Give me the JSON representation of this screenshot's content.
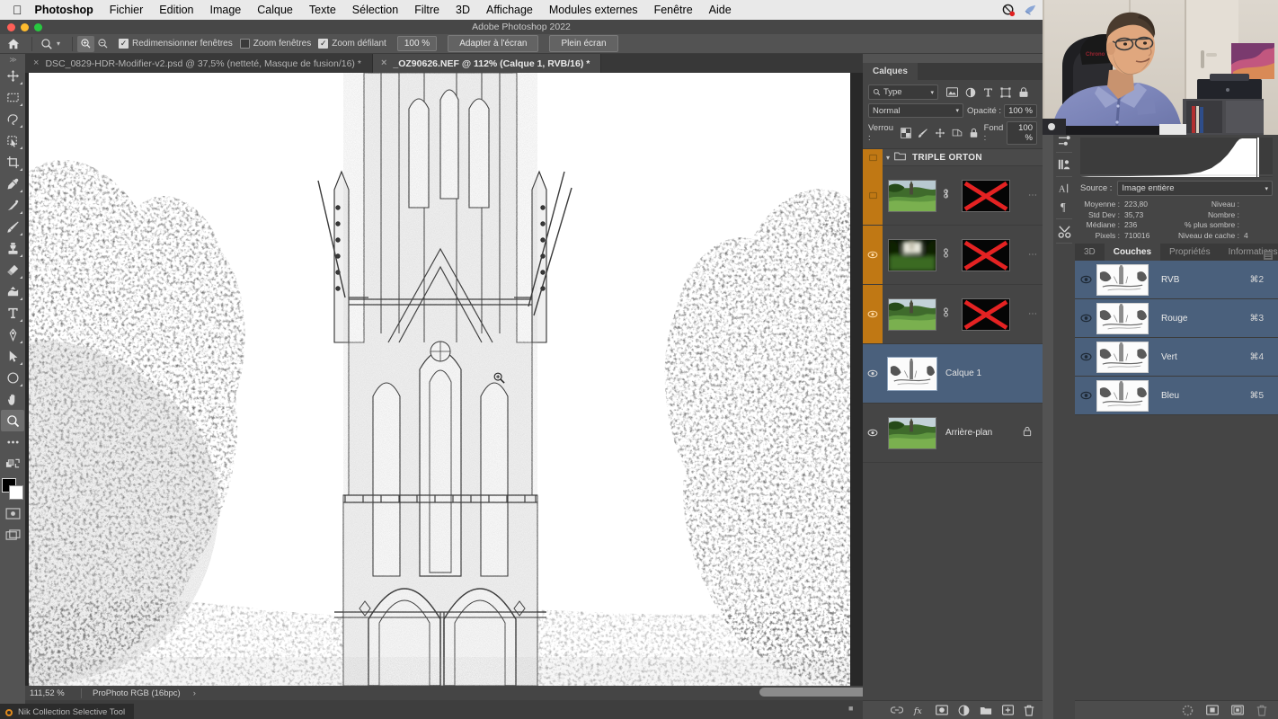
{
  "menubar": {
    "apple_icon": "apple-logo-icon",
    "items": [
      {
        "label": "Photoshop",
        "bold": true
      },
      {
        "label": "Fichier",
        "bold": false
      },
      {
        "label": "Edition",
        "bold": false
      },
      {
        "label": "Image",
        "bold": false
      },
      {
        "label": "Calque",
        "bold": false
      },
      {
        "label": "Texte",
        "bold": false
      },
      {
        "label": "Sélection",
        "bold": false
      },
      {
        "label": "Filtre",
        "bold": false
      },
      {
        "label": "3D",
        "bold": false
      },
      {
        "label": "Affichage",
        "bold": false
      },
      {
        "label": "Modules externes",
        "bold": false
      },
      {
        "label": "Fenêtre",
        "bold": false
      },
      {
        "label": "Aide",
        "bold": false
      }
    ],
    "status_icons": [
      "recording-icon",
      "bird-icon",
      "notification-dots-icon",
      "camera-video-icon",
      "display-icon",
      "clipboard-icon",
      "time-machine-icon",
      "binoculars-icon",
      "sidebar-icon",
      "monitor-icon",
      "volume-icon",
      "play-circle-icon",
      "user-icon"
    ]
  },
  "window": {
    "title": "Adobe Photoshop 2022",
    "traffic_lights": [
      "close-button",
      "minimize-button",
      "maximize-button"
    ],
    "traffic_colors": {
      "close": "#ff5f57",
      "minimize": "#febc2e",
      "maximize": "#28c840"
    }
  },
  "options_bar": {
    "home_icon": "home-icon",
    "tool_icon": "zoom-tool-icon",
    "chevron": "chevron-down-icon",
    "zoom_in_icon": "zoom-in-icon",
    "zoom_out_icon": "zoom-out-icon",
    "checkboxes": [
      {
        "label": "Redimensionner fenêtres",
        "checked": true,
        "mark": "✓"
      },
      {
        "label": "Zoom fenêtres",
        "checked": false,
        "mark": ""
      },
      {
        "label": "Zoom défilant",
        "checked": true,
        "mark": "✓"
      }
    ],
    "zoom_level": "100 %",
    "fit_screen_label": "Adapter à l'écran",
    "fullscreen_label": "Plein écran"
  },
  "tabs": [
    {
      "label": "DSC_0829-HDR-Modifier-v2.psd @ 37,5% (netteté, Masque de fusion/16) *",
      "active": false,
      "close": "×"
    },
    {
      "label": "_OZ90626.NEF @ 112% (Calque 1, RVB/16) *",
      "active": true,
      "close": "×"
    }
  ],
  "toolbar": {
    "tools": [
      {
        "name": "move-tool",
        "selected": false
      },
      {
        "name": "rectangular-marquee-tool",
        "selected": false
      },
      {
        "name": "lasso-tool",
        "selected": false
      },
      {
        "name": "object-selection-tool",
        "selected": false
      },
      {
        "name": "crop-tool",
        "selected": false
      },
      {
        "name": "eyedropper-tool",
        "selected": false
      },
      {
        "name": "healing-brush-tool",
        "selected": false
      },
      {
        "name": "brush-tool",
        "selected": false
      },
      {
        "name": "clone-stamp-tool",
        "selected": false
      },
      {
        "name": "eraser-tool",
        "selected": false
      },
      {
        "name": "gradient-tool",
        "selected": false
      },
      {
        "name": "type-tool",
        "selected": false
      },
      {
        "name": "pen-tool",
        "selected": false
      },
      {
        "name": "path-selection-tool",
        "selected": false
      },
      {
        "name": "ellipse-shape-tool",
        "selected": false
      },
      {
        "name": "hand-tool",
        "selected": false
      },
      {
        "name": "zoom-tool",
        "selected": true
      },
      {
        "name": "more-tools-icon",
        "selected": false
      },
      {
        "name": "swap-colors-icon",
        "selected": false
      }
    ],
    "foreground_color": "#000000",
    "background_color": "#ffffff",
    "quick_mask_icon": "quick-mask-icon",
    "screen_mode_icon": "screen-mode-icon"
  },
  "canvas": {
    "document_description": "Gothic cathedral pencil-sketch effect on white background with trees",
    "cursor": "zoom-in-cursor"
  },
  "statusbar": {
    "zoom": "111,52 %",
    "profile": "ProPhoto RGB (16bpc)",
    "arrow": "›"
  },
  "tooltip": {
    "label": "Nik Collection Selective Tool",
    "icon": "nik-collection-icon"
  },
  "layers_panel": {
    "tab_label": "Calques",
    "filter": {
      "search_icon": "search-icon",
      "type_label": "Type",
      "chevron": "chevron-down-icon",
      "filter_icons": [
        "pixel-layer-filter-icon",
        "adjustment-layer-filter-icon",
        "type-layer-filter-icon",
        "shape-layer-filter-icon",
        "smart-object-filter-icon"
      ],
      "toggle_icon": "filter-toggle-icon"
    },
    "blend_mode": "Normal",
    "opacity_label": "Opacité :",
    "opacity_value": "100 %",
    "lock_label": "Verrou :",
    "lock_icons": [
      "lock-transparency-icon",
      "lock-image-icon",
      "lock-position-icon",
      "lock-artboard-icon",
      "lock-all-icon"
    ],
    "fill_label": "Fond :",
    "fill_value": "100 %",
    "group": {
      "name": "TRIPLE ORTON",
      "expanded": true,
      "visible": false,
      "folder_icon": "folder-icon",
      "chevron": "chevron-down-icon"
    },
    "layers": [
      {
        "name": "",
        "visible": false,
        "has_mask": true,
        "mask_crossed": true,
        "thumb": "park-sharp",
        "selected": false,
        "link_icon": "link-icon",
        "dots": "⋯"
      },
      {
        "name": "",
        "visible": true,
        "has_mask": true,
        "mask_crossed": true,
        "thumb": "park-blur",
        "selected": false,
        "link_icon": "link-icon",
        "dots": "⋯"
      },
      {
        "name": "",
        "visible": true,
        "has_mask": true,
        "mask_crossed": true,
        "thumb": "park-sharp",
        "selected": false,
        "link_icon": "link-icon",
        "dots": "⋯"
      },
      {
        "name": "Calque 1",
        "visible": true,
        "has_mask": false,
        "mask_crossed": false,
        "thumb": "sketch",
        "selected": true,
        "link_icon": "",
        "dots": ""
      },
      {
        "name": "Arrière-plan",
        "visible": true,
        "has_mask": false,
        "mask_crossed": false,
        "thumb": "park-sharp",
        "selected": false,
        "locked": true,
        "lock_icon": "lock-icon",
        "dots": ""
      }
    ],
    "footer_icons": [
      "link-layers-icon",
      "layer-style-fx-icon",
      "add-mask-icon",
      "adjustment-layer-icon",
      "new-group-icon",
      "new-layer-icon",
      "delete-layer-icon"
    ]
  },
  "icon_dock": {
    "icons": [
      "adjustments-icon",
      "libraries-icon",
      "character-icon",
      "paragraph-icon",
      "actions-icon"
    ]
  },
  "histogram_panel": {
    "source_label": "Source :",
    "source_value": "Image entière",
    "chevron": "chevron-down-icon",
    "stats_left": [
      {
        "key": "Moyenne :",
        "value": "223,80"
      },
      {
        "key": "Std Dev :",
        "value": "35,73"
      },
      {
        "key": "Médiane :",
        "value": "236"
      },
      {
        "key": "Pixels :",
        "value": "710016"
      }
    ],
    "stats_right": [
      {
        "key": "Niveau :",
        "value": ""
      },
      {
        "key": "Nombre :",
        "value": ""
      },
      {
        "key": "% plus sombre :",
        "value": ""
      },
      {
        "key": "Niveau de cache :",
        "value": "4"
      }
    ]
  },
  "channels_panel": {
    "tabs": [
      {
        "label": "3D",
        "active": false
      },
      {
        "label": "Couches",
        "active": true
      },
      {
        "label": "Propriétés",
        "active": false
      },
      {
        "label": "Informations",
        "active": false
      }
    ],
    "menu_icon": "panel-menu-icon",
    "channels": [
      {
        "name": "RVB",
        "shortcut": "⌘2",
        "visible": true,
        "selected": true
      },
      {
        "name": "Rouge",
        "shortcut": "⌘3",
        "visible": true,
        "selected": true
      },
      {
        "name": "Vert",
        "shortcut": "⌘4",
        "visible": true,
        "selected": true
      },
      {
        "name": "Bleu",
        "shortcut": "⌘5",
        "visible": true,
        "selected": true
      }
    ],
    "footer_icons": [
      "load-selection-icon",
      "save-selection-icon",
      "new-channel-icon",
      "delete-channel-icon"
    ]
  },
  "webcam": {
    "description": "Man with glasses in blue shirt seated in office chair"
  },
  "colors": {
    "panel_bg": "#454545",
    "app_bg": "#535353",
    "canvas_bg": "#282828",
    "selection_blue": "#4a607c",
    "visibility_orange": "#c07814",
    "mask_red": "#e02020",
    "accent_text": "#e2e2e2"
  }
}
